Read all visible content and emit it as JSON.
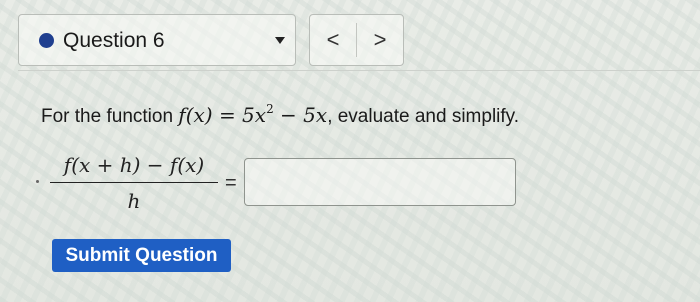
{
  "question_selector": {
    "label": "Question 6",
    "icons": {
      "status": "filled-circle-icon",
      "dropdown": "caret-down-icon"
    },
    "accent_color": "#1f3f8f"
  },
  "navigation": {
    "previous_label": "<",
    "next_label": ">",
    "icons": {
      "previous": "chevron-left-icon",
      "next": "chevron-right-icon"
    }
  },
  "problem": {
    "lead": "For the function ",
    "function_text": "f(x) = 5x",
    "exponent": "2",
    "function_tail": " − 5x",
    "instruction": ", evaluate and simplify."
  },
  "expression": {
    "numerator": "f(x + h) − f(x)",
    "denominator": "h",
    "equals": "="
  },
  "answer": {
    "value": "",
    "placeholder": ""
  },
  "actions": {
    "submit_label": "Submit Question",
    "submit_color": "#1f5fc4"
  }
}
